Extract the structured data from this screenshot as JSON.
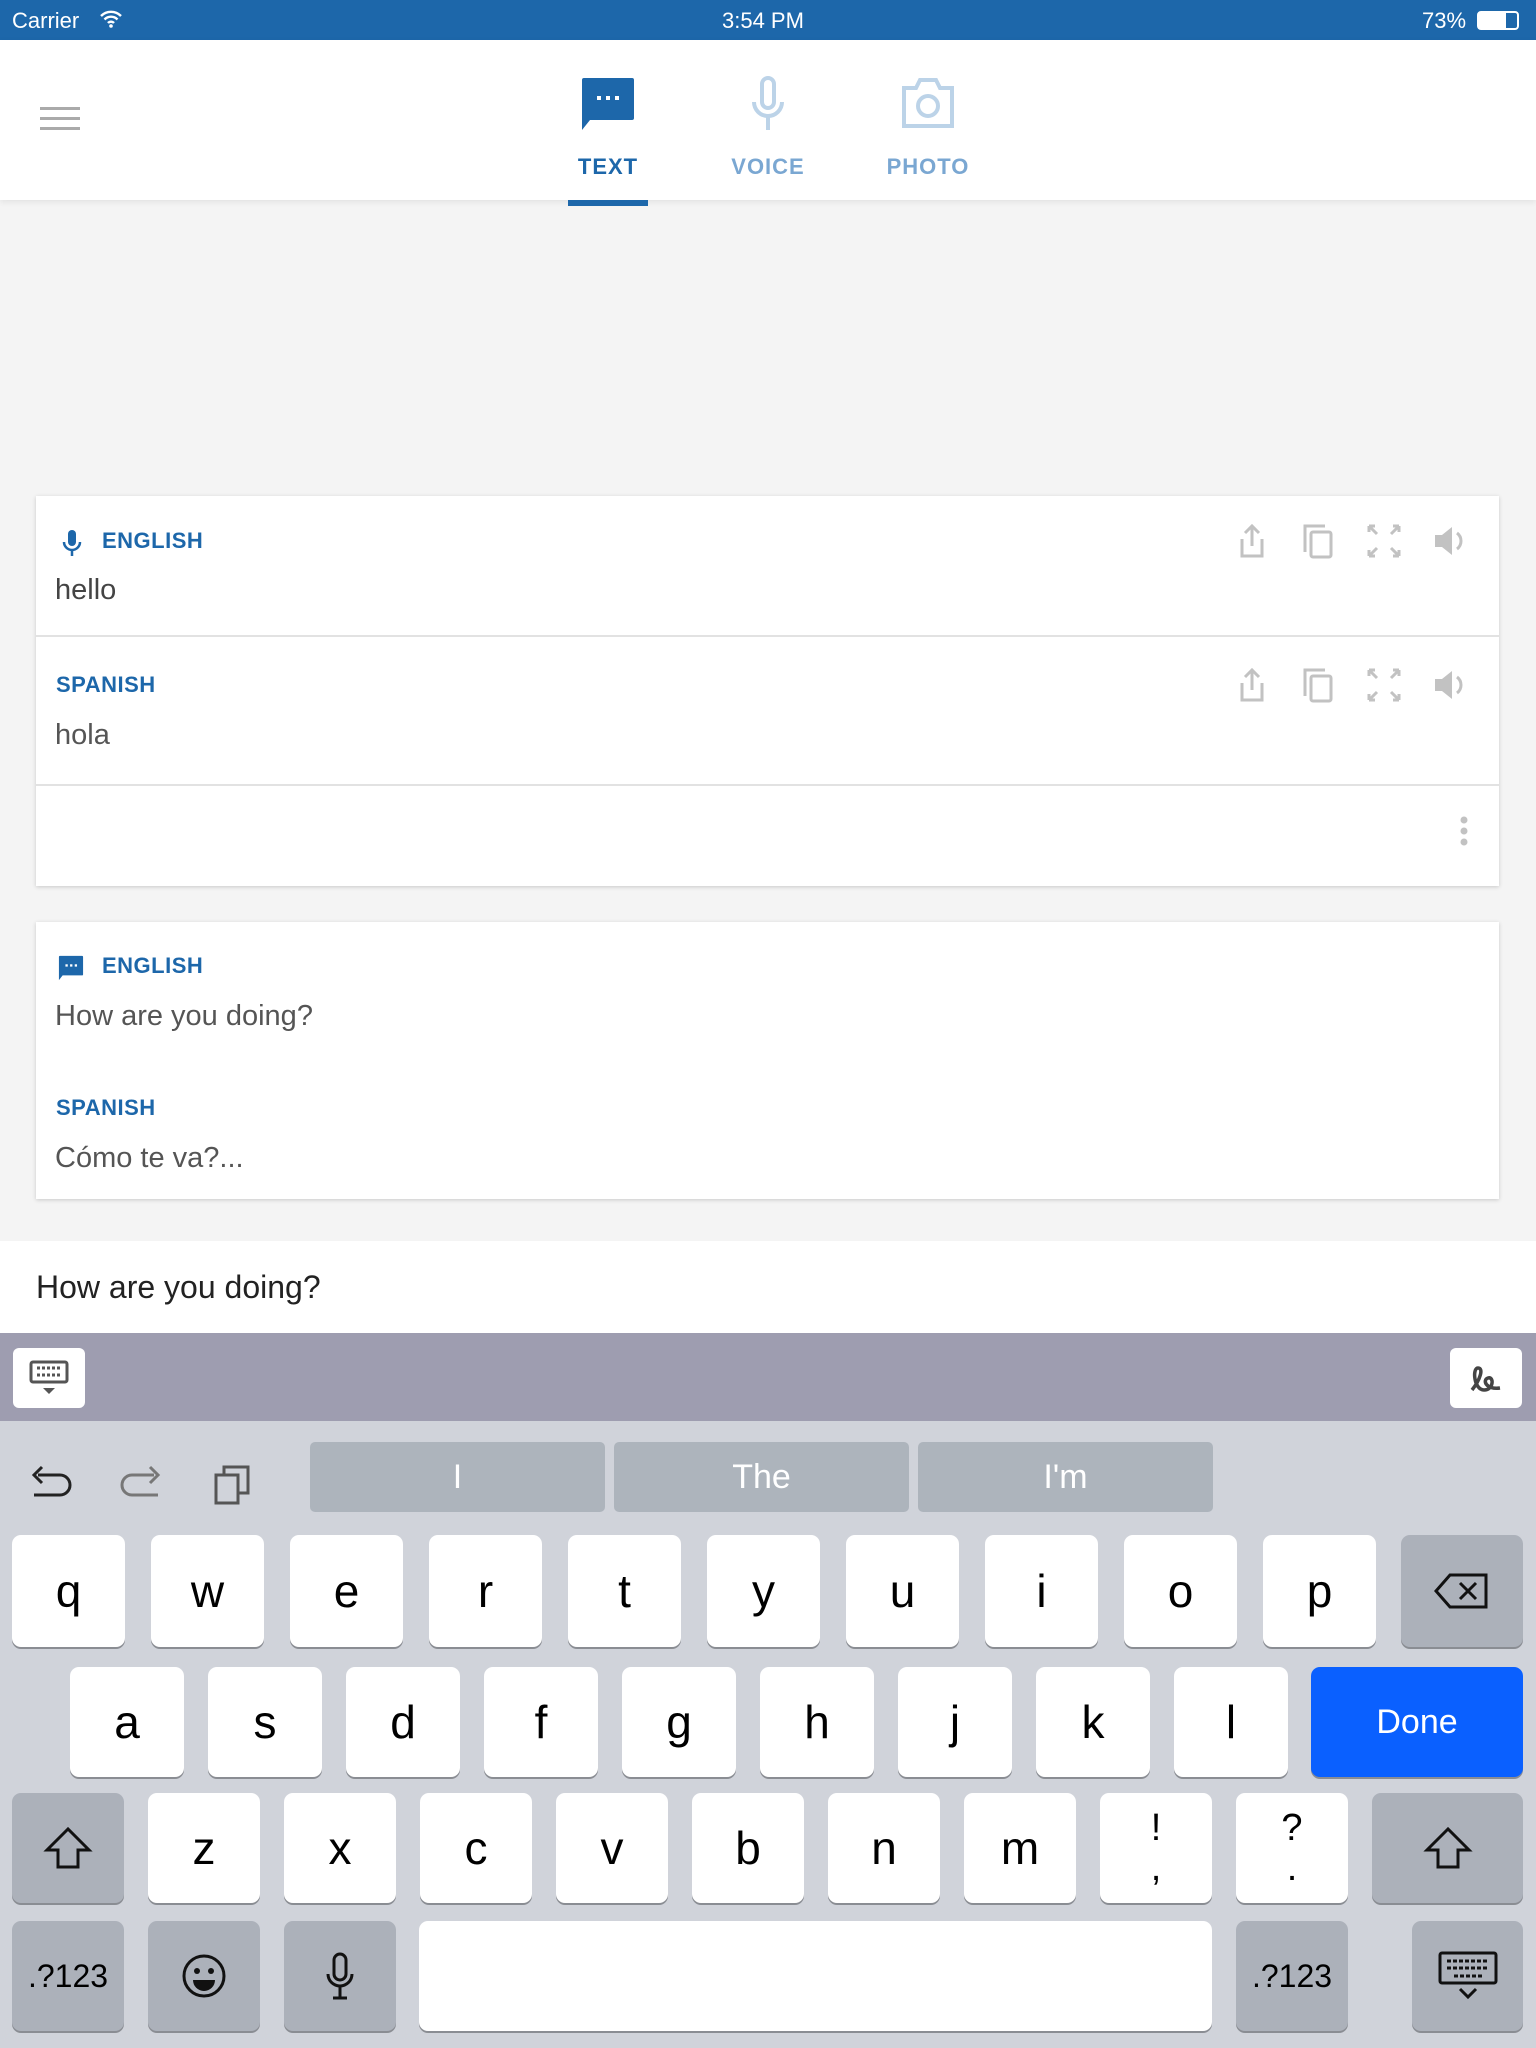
{
  "status": {
    "carrier": "Carrier",
    "time": "3:54 PM",
    "battery": "73%"
  },
  "tabs": [
    {
      "label": "TEXT",
      "active": true
    },
    {
      "label": "VOICE",
      "active": false
    },
    {
      "label": "PHOTO",
      "active": false
    }
  ],
  "colors": {
    "accent": "#1d67aa",
    "inactive_tab": "#7aa7d2",
    "done": "#0a60ff"
  },
  "cards": [
    {
      "source_lang": "ENGLISH",
      "source_icon": "mic-icon",
      "source_text": "hello",
      "target_lang": "SPANISH",
      "target_text": "hola"
    },
    {
      "source_lang": "ENGLISH",
      "source_icon": "chat-icon",
      "source_text": "How are you doing?",
      "target_lang": "SPANISH",
      "target_text": "Cómo te va?..."
    }
  ],
  "input": {
    "value": "How are you doing?"
  },
  "keyboard": {
    "suggestions": [
      "I",
      "The",
      "I'm"
    ],
    "row1": [
      "q",
      "w",
      "e",
      "r",
      "t",
      "y",
      "u",
      "i",
      "o",
      "p"
    ],
    "row2": [
      "a",
      "s",
      "d",
      "f",
      "g",
      "h",
      "j",
      "k",
      "l"
    ],
    "done": "Done",
    "row3": [
      "z",
      "x",
      "c",
      "v",
      "b",
      "n",
      "m"
    ],
    "punct1": [
      "!",
      ","
    ],
    "punct2": [
      "?",
      "."
    ],
    "numbers": ".?123"
  }
}
